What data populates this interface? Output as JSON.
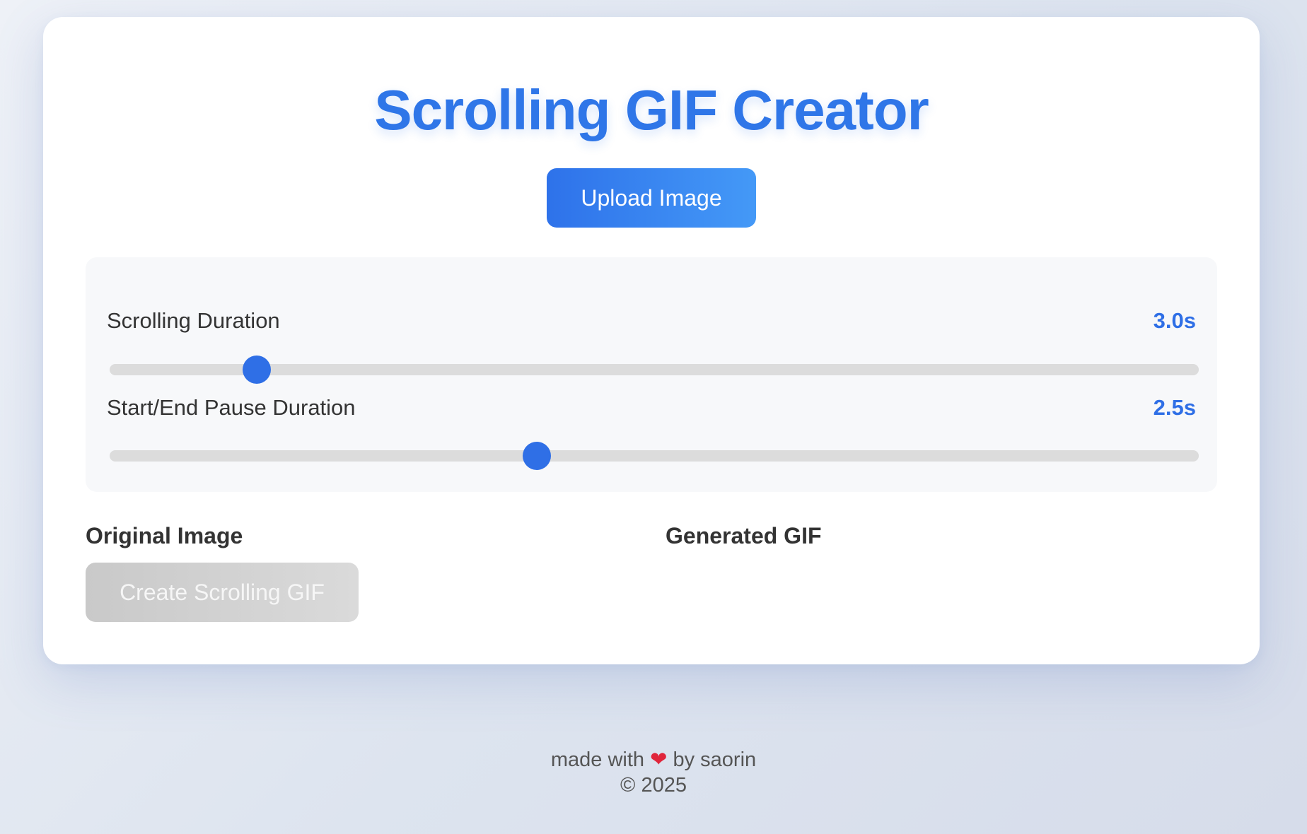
{
  "header": {
    "title": "Scrolling GIF Creator"
  },
  "upload": {
    "label": "Upload Image"
  },
  "settings": {
    "scrolling_duration": {
      "label": "Scrolling Duration",
      "value_text": "3.0s",
      "fraction": 0.135
    },
    "pause_duration": {
      "label": "Start/End Pause Duration",
      "value_text": "2.5s",
      "fraction": 0.392
    }
  },
  "original": {
    "heading": "Original Image",
    "create_label": "Create Scrolling GIF",
    "create_enabled": false
  },
  "generated": {
    "heading": "Generated GIF"
  },
  "footer": {
    "made_prefix": "made with",
    "heart": "❤",
    "made_suffix": "by saorin",
    "copyright": "© 2025"
  },
  "colors": {
    "accent": "#2f6fe6",
    "title": "#2f76e8",
    "disabled_button": "#d0d0d0",
    "heart": "#e0253b"
  }
}
